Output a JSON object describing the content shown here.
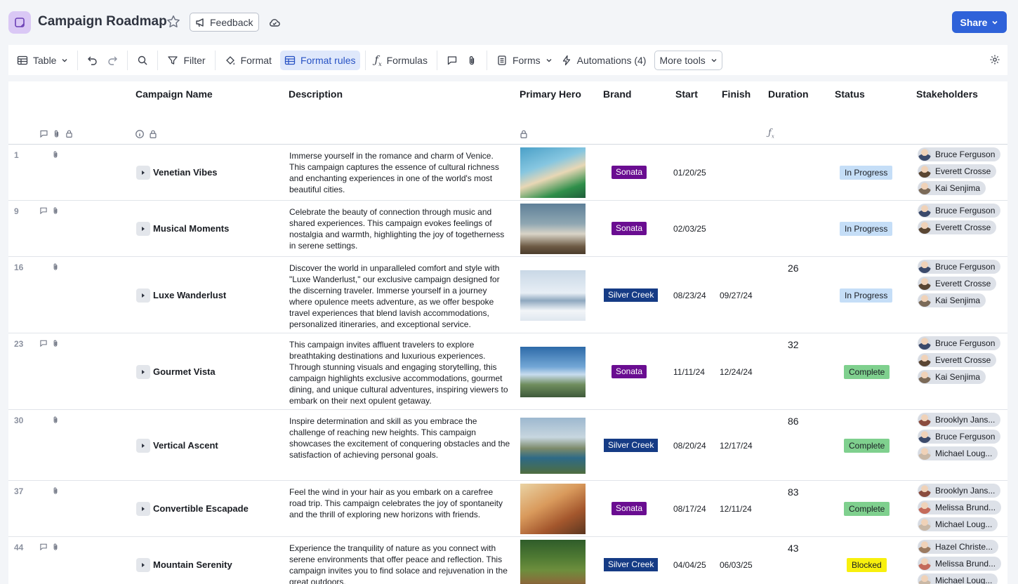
{
  "header": {
    "title": "Campaign Roadmap",
    "feedback_label": "Feedback",
    "share_label": "Share"
  },
  "toolbar": {
    "table": "Table",
    "filter": "Filter",
    "format": "Format",
    "format_rules": "Format rules",
    "formulas": "Formulas",
    "forms": "Forms",
    "automations": "Automations (4)",
    "more_tools": "More tools"
  },
  "columns": {
    "name": "Campaign Name",
    "description": "Description",
    "hero": "Primary Hero",
    "brand": "Brand",
    "start": "Start",
    "finish": "Finish",
    "duration": "Duration",
    "status": "Status",
    "stakeholders": "Stakeholders"
  },
  "colors": {
    "accent": "#2f62d9",
    "sonata": "#6a0d91",
    "silver_creek": "#153b85",
    "in_progress": "#c5def7",
    "complete": "#7fd08e",
    "blocked": "#f8f00d"
  },
  "rows": [
    {
      "num": "1",
      "name": "Venetian Vibes",
      "description": "Immerse yourself in the romance and charm of Venice. This campaign captures the essence of cultural richness and enchanting experiences in one of the world's most beautiful cities.",
      "brand": "Sonata",
      "start": "01/20/25",
      "finish": "",
      "duration": "",
      "status": "In Progress",
      "stakeholders": [
        "Bruce Ferguson",
        "Everett Crosse",
        "Kai Senjima"
      ]
    },
    {
      "num": "9",
      "name": "Musical Moments",
      "description": "Celebrate the beauty of connection through music and shared experiences. This campaign evokes feelings of nostalgia and warmth, highlighting the joy of togetherness in serene settings.",
      "brand": "Sonata",
      "start": "02/03/25",
      "finish": "",
      "duration": "",
      "status": "In Progress",
      "stakeholders": [
        "Bruce Ferguson",
        "Everett Crosse"
      ]
    },
    {
      "num": "16",
      "name": "Luxe Wanderlust",
      "description": "Discover the world in unparalleled comfort and style with \"Luxe Wanderlust,\" our exclusive campaign designed for the discerning traveler. Immerse yourself in a journey where opulence meets adventure, as we offer bespoke travel experiences that blend lavish accommodations, personalized itineraries, and exceptional service.",
      "brand": "Silver Creek",
      "start": "08/23/24",
      "finish": "09/27/24",
      "duration": "26",
      "status": "In Progress",
      "stakeholders": [
        "Bruce Ferguson",
        "Everett Crosse",
        "Kai Senjima"
      ]
    },
    {
      "num": "23",
      "name": "Gourmet Vista",
      "description": "This campaign invites affluent travelers to explore breathtaking destinations and luxurious experiences. Through stunning visuals and engaging storytelling, this campaign highlights exclusive accommodations, gourmet dining, and unique cultural adventures, inspiring viewers to embark on their next opulent getaway.",
      "brand": "Sonata",
      "start": "11/11/24",
      "finish": "12/24/24",
      "duration": "32",
      "status": "Complete",
      "stakeholders": [
        "Bruce Ferguson",
        "Everett Crosse",
        "Kai Senjima"
      ]
    },
    {
      "num": "30",
      "name": "Vertical Ascent",
      "description": "Inspire determination and skill as you embrace the challenge of reaching new heights. This campaign showcases the excitement of conquering obstacles and the satisfaction of achieving personal goals.",
      "brand": "Silver Creek",
      "start": "08/20/24",
      "finish": "12/17/24",
      "duration": "86",
      "status": "Complete",
      "stakeholders": [
        "Brooklyn Jans...",
        "Bruce Ferguson",
        "Michael Loug..."
      ]
    },
    {
      "num": "37",
      "name": "Convertible Escapade",
      "description": "Feel the wind in your hair as you embark on a carefree road trip. This campaign celebrates the joy of spontaneity and the thrill of exploring new horizons with friends.",
      "brand": "Sonata",
      "start": "08/17/24",
      "finish": "12/11/24",
      "duration": "83",
      "status": "Complete",
      "stakeholders": [
        "Brooklyn Jans...",
        "Melissa Brund...",
        "Michael Loug..."
      ]
    },
    {
      "num": "44",
      "name": "Mountain Serenity",
      "description": "Experience the tranquility of nature as you connect with serene environments that offer peace and reflection. This campaign invites you to find solace and rejuvenation in the great outdoors.",
      "brand": "Silver Creek",
      "start": "04/04/25",
      "finish": "06/03/25",
      "duration": "43",
      "status": "Blocked",
      "stakeholders": [
        "Hazel Christe...",
        "Melissa Brund...",
        "Michael Loug..."
      ]
    }
  ]
}
